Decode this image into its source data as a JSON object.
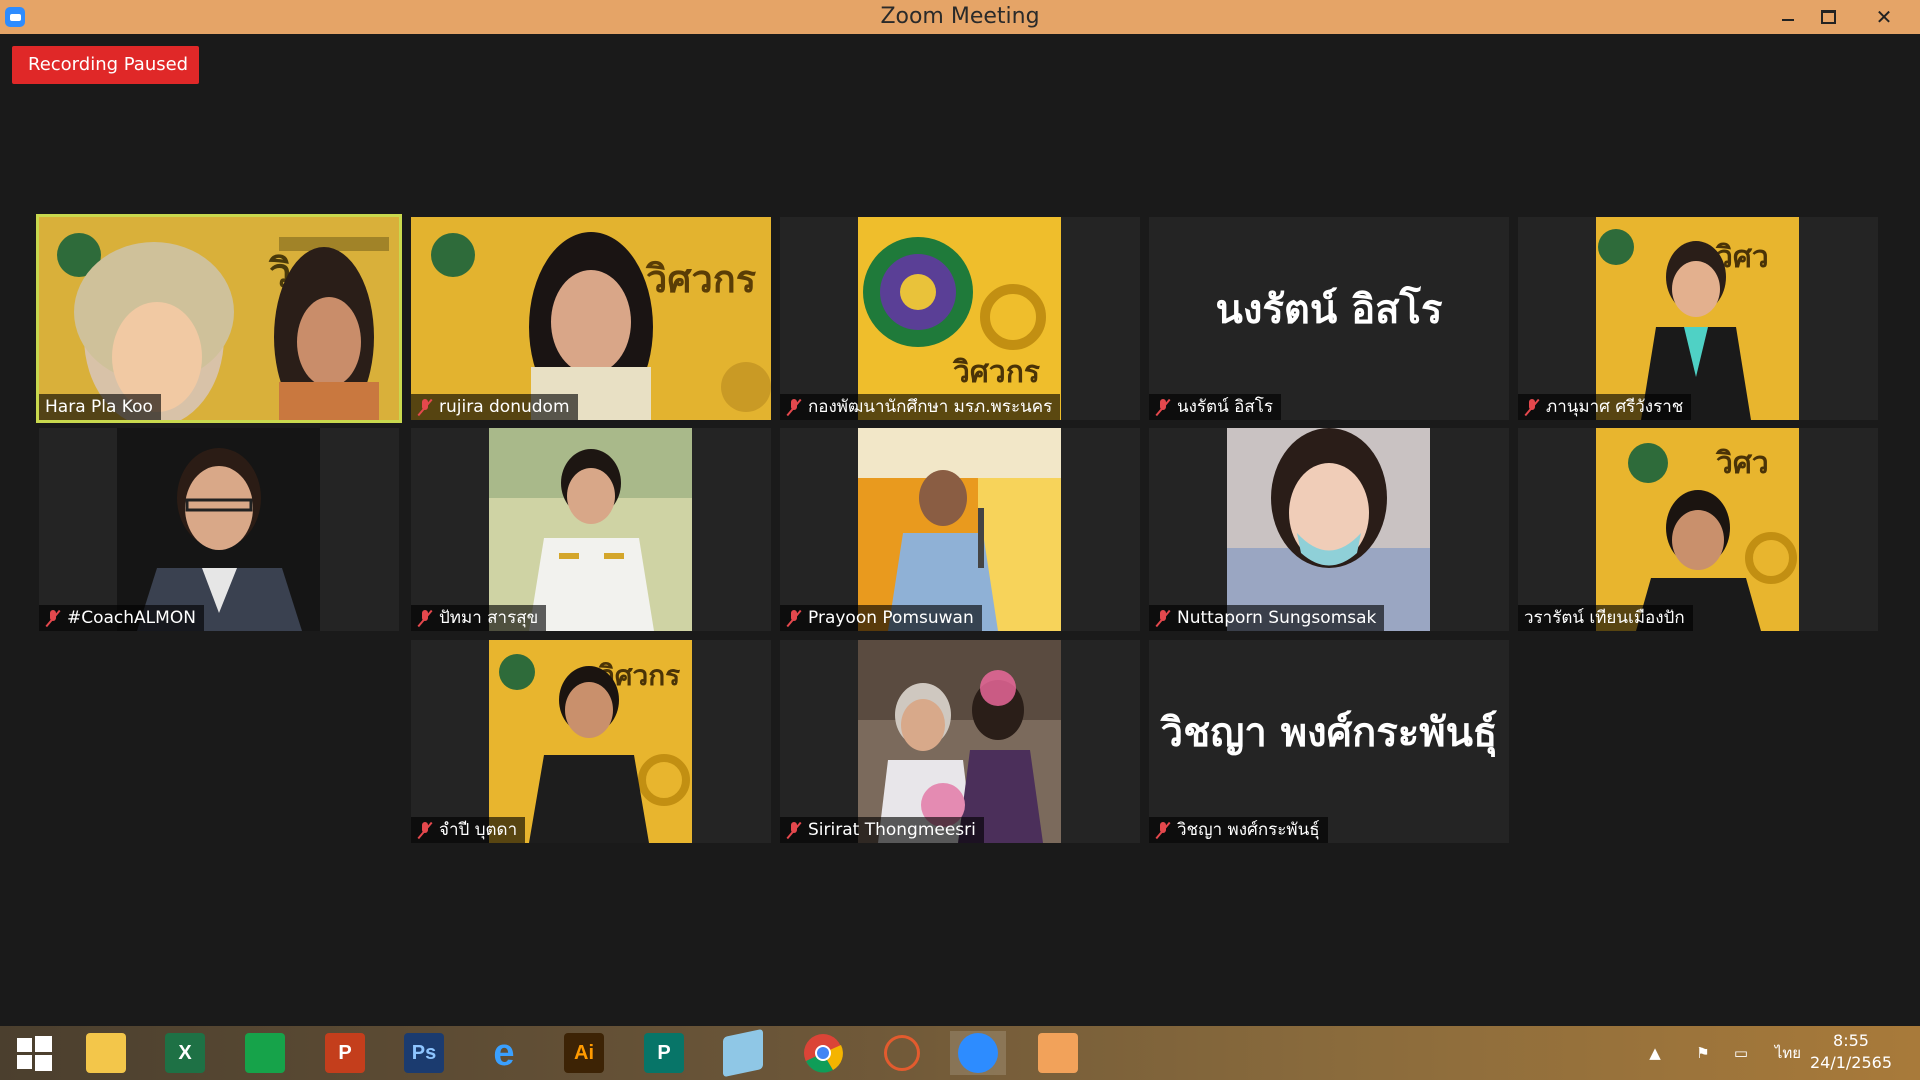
{
  "window": {
    "title": "Zoom Meeting",
    "icons": {
      "app": "zoom-icon",
      "minimize": "minimize-icon",
      "maximize": "restore-icon",
      "close": "close-icon"
    },
    "close_label": "✕"
  },
  "recording_badge": "Recording Paused",
  "participants": [
    {
      "name": "Hara Pla Koo",
      "muted": false,
      "active": true,
      "kind": "photo"
    },
    {
      "name": "rujira donudom",
      "muted": true,
      "kind": "photo"
    },
    {
      "name": "กองพัฒนานักศึกษา มรภ.พระนคร",
      "muted": true,
      "kind": "photo"
    },
    {
      "name": "นงรัตน์ อิสโร",
      "display_text": "นงรัตน์ อิสโร",
      "muted": true,
      "kind": "text"
    },
    {
      "name": "ภานุมาศ ศรีวังราช",
      "muted": true,
      "kind": "photo"
    },
    {
      "name": "#CoachALMON",
      "muted": true,
      "kind": "photo"
    },
    {
      "name": "ปัทมา สารสุข",
      "muted": true,
      "kind": "photo"
    },
    {
      "name": "Prayoon Pomsuwan",
      "muted": true,
      "kind": "photo"
    },
    {
      "name": "Nuttaporn Sungsomsak",
      "muted": true,
      "kind": "photo"
    },
    {
      "name": "วรารัตน์ เทียนเมืองปัก",
      "muted": true,
      "kind": "photo"
    },
    {
      "name": "จำปี บุตดา",
      "muted": true,
      "kind": "photo"
    },
    {
      "name": "Sirirat Thongmeesri",
      "muted": true,
      "kind": "photo"
    },
    {
      "name": "วิชญา พงศ์กระพันธุ์",
      "display_text": "วิชญา พงศ์กระพันธุ์",
      "muted": true,
      "kind": "text"
    }
  ],
  "taskbar": {
    "apps": [
      {
        "name": "windows-start-icon"
      },
      {
        "name": "file-explorer-icon"
      },
      {
        "name": "excel-icon",
        "label": "X"
      },
      {
        "name": "store-icon"
      },
      {
        "name": "powerpoint-icon",
        "label": "P"
      },
      {
        "name": "photoshop-icon",
        "label": "Ps"
      },
      {
        "name": "internet-explorer-icon",
        "label": "e"
      },
      {
        "name": "illustrator-icon",
        "label": "Ai"
      },
      {
        "name": "publisher-icon",
        "label": "P"
      },
      {
        "name": "notes-icon"
      },
      {
        "name": "chrome-icon"
      },
      {
        "name": "snipping-tool-icon"
      },
      {
        "name": "zoom-icon"
      },
      {
        "name": "presentation-app-icon"
      }
    ],
    "tray": {
      "overflow_icon": "chevron-up-icon",
      "flag_icon": "action-center-flag-icon",
      "network_icon": "network-icon",
      "language": "ไทย"
    },
    "clock_time": "8:55",
    "clock_date": "24/1/2565"
  }
}
